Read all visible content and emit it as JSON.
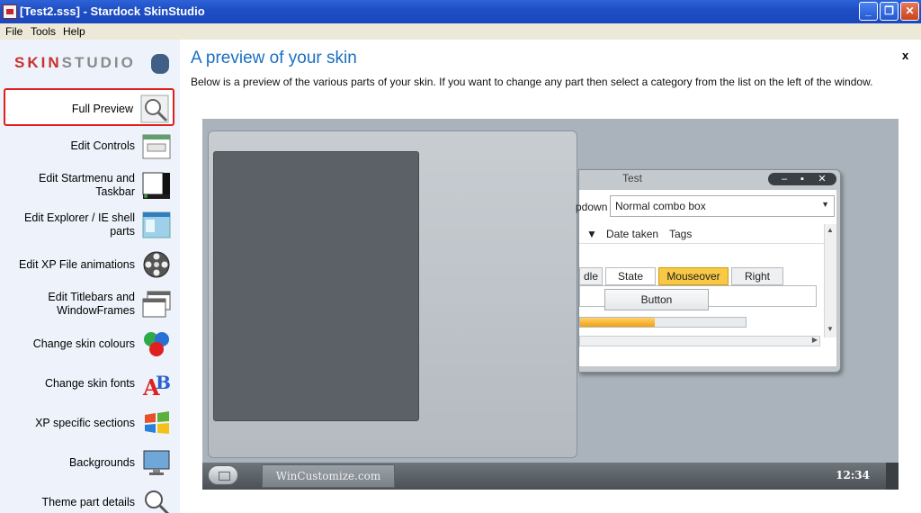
{
  "window": {
    "title": "[Test2.sss] - Stardock SkinStudio",
    "min_glyph": "_",
    "max_glyph": "❐",
    "close_glyph": "✕"
  },
  "menu": [
    "File",
    "Tools",
    "Help"
  ],
  "sidebar": {
    "logo": {
      "part1": "SKIN",
      "part2": "STUDIO"
    },
    "items": [
      {
        "label": "Full Preview",
        "icon": "magnifier-icon",
        "active": true
      },
      {
        "label": "Edit Controls",
        "icon": "controls-window-icon"
      },
      {
        "label": "Edit Startmenu and Taskbar",
        "icon": "startmenu-taskbar-icon"
      },
      {
        "label": "Edit Explorer / IE shell parts",
        "icon": "explorer-shell-icon"
      },
      {
        "label": "Edit XP File animations",
        "icon": "film-reel-icon"
      },
      {
        "label": "Edit Titlebars and WindowFrames",
        "icon": "window-frames-icon"
      },
      {
        "label": "Change skin colours",
        "icon": "color-balls-icon"
      },
      {
        "label": "Change skin fonts",
        "icon": "fonts-ab-icon"
      },
      {
        "label": "XP specific sections",
        "icon": "windows-flag-icon"
      },
      {
        "label": "Backgrounds",
        "icon": "monitor-icon"
      },
      {
        "label": "Theme part details",
        "icon": "magnifier-icon"
      }
    ]
  },
  "main": {
    "title": "A preview of your skin",
    "description": "Below is a preview of the various parts of your skin.  If you want to change any part then select a category from the list on the left of the window.",
    "close_label": "x"
  },
  "preview": {
    "test_window": {
      "title": "Test",
      "buttons": [
        "–",
        "▪",
        "✕"
      ],
      "combo_label": "pdown",
      "combo_value": "Normal combo box",
      "list_headers": [
        "Date taken",
        "Tags"
      ],
      "tabs": [
        "dle",
        "State",
        "Mouseover",
        "Right"
      ],
      "button_label": "Button",
      "progress": 0.45
    },
    "taskbar": {
      "item": "WinCustomize.com",
      "clock": "12:34"
    }
  },
  "colors": {
    "title_blue": "#1b6fc2",
    "active_border": "#e02020",
    "tab_hover": "#f8c944",
    "sidebar_bg": "#eef3fb"
  }
}
